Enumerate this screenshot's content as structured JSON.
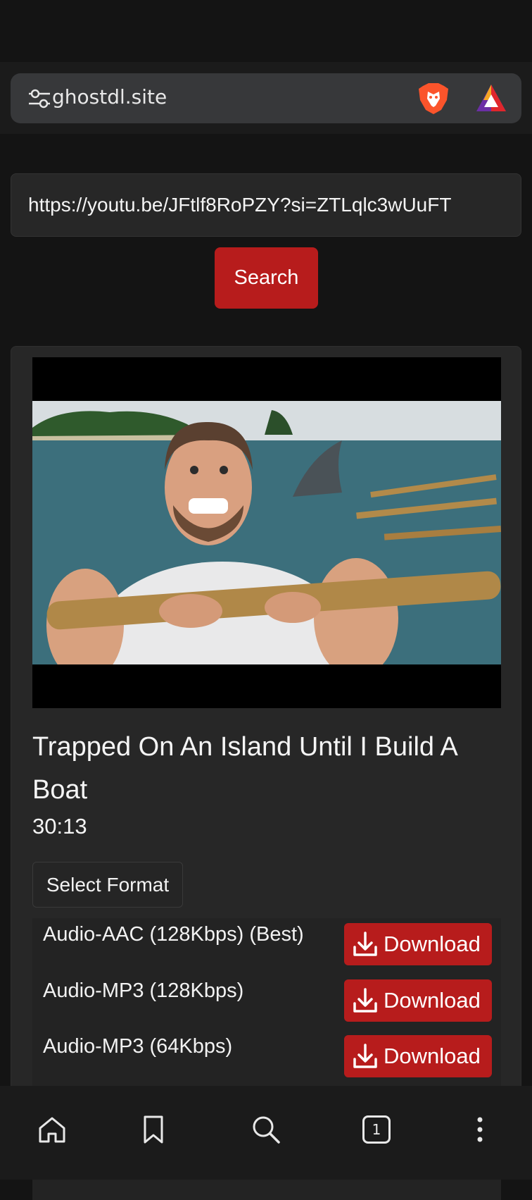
{
  "browser": {
    "url": "ghostdl.site",
    "icons": [
      "tune-icon",
      "brave-lion-icon",
      "brave-rewards-icon"
    ]
  },
  "search": {
    "input_value": "https://youtu.be/JFtlf8RoPZY?si=ZTLqlc3wUuFT",
    "button_label": "Search"
  },
  "video": {
    "title": "Trapped On An Island Until I Build A Boat",
    "duration": "30:13",
    "select_format_label": "Select Format"
  },
  "formats": [
    {
      "label": "Audio-AAC (128Kbps) (Best)",
      "button": "Download"
    },
    {
      "label": "Audio-MP3 (128Kbps)",
      "button": "Download"
    },
    {
      "label": "Audio-MP3 (64Kbps)",
      "button": "Download"
    }
  ],
  "bottom_nav": {
    "items": [
      "home-icon",
      "bookmark-icon",
      "search-icon",
      "tabs-icon",
      "more-icon"
    ],
    "tab_count": "1"
  },
  "colors": {
    "accent": "#b71c1c",
    "background": "#141414",
    "card": "#272727"
  }
}
